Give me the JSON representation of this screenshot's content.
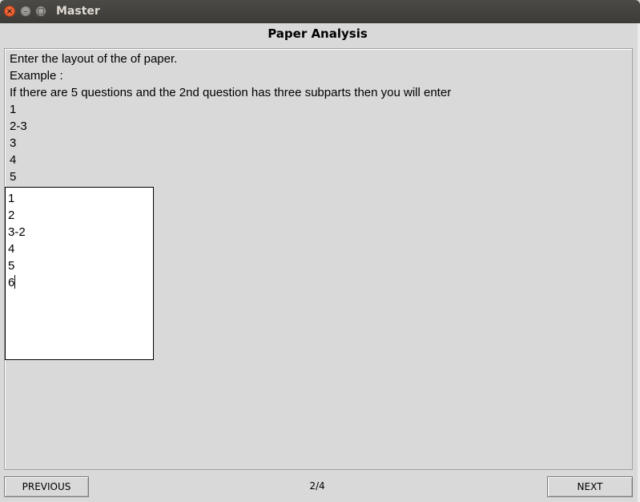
{
  "window": {
    "title": "Master",
    "controls": [
      "close-icon",
      "minimize-icon",
      "maximize-icon"
    ]
  },
  "page": {
    "heading": "Paper Analysis"
  },
  "instructions": {
    "line1": "Enter the layout of the of paper.",
    "line2": "Example :",
    "line3": "If there are 5 questions and the 2nd question has three subparts then you will enter",
    "example": [
      "1",
      "2-3",
      "3",
      "4",
      "5"
    ]
  },
  "input": {
    "lines": [
      "1",
      "2",
      "3-2",
      "4",
      "5",
      "6"
    ]
  },
  "navigation": {
    "previous_label": "PREVIOUS",
    "page_indicator": "2/4",
    "next_label": "NEXT"
  },
  "colors": {
    "background": "#d9d9d9",
    "titlebar": "#3c3b37",
    "close_button": "#e95420"
  }
}
